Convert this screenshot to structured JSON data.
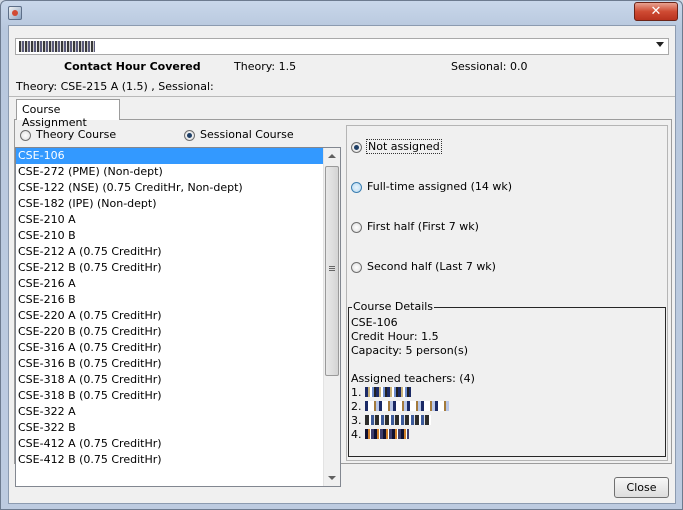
{
  "window": {
    "close_glyph": "✕",
    "app_icon": "java-cup-icon"
  },
  "header": {
    "course_combo": {
      "value_is_obscured": true,
      "arrow_icon": "chevron-down-icon"
    },
    "contact_title": "Contact Hour Covered",
    "theory_label": "Theory: 1.5",
    "sessional_label": "Sessional: 0.0",
    "summary": "Theory: CSE-215 A (1.5) , Sessional:"
  },
  "tabs": [
    {
      "label": "Course Assignment"
    }
  ],
  "course_type": {
    "options": [
      {
        "label": "Theory Course",
        "checked": false
      },
      {
        "label": "Sessional Course",
        "checked": true
      }
    ]
  },
  "courses": {
    "selected_index": 0,
    "items": [
      "CSE-106",
      "CSE-272 (PME) (Non-dept)",
      "CSE-122 (NSE) (0.75 CreditHr, Non-dept)",
      "CSE-182 (IPE) (Non-dept)",
      "CSE-210 A",
      "CSE-210 B",
      "CSE-212 A (0.75 CreditHr)",
      "CSE-212 B (0.75 CreditHr)",
      "CSE-216 A",
      "CSE-216 B",
      "CSE-220 A (0.75 CreditHr)",
      "CSE-220 B (0.75 CreditHr)",
      "CSE-316 A (0.75 CreditHr)",
      "CSE-316 B (0.75 CreditHr)",
      "CSE-318 A (0.75 CreditHr)",
      "CSE-318 B (0.75 CreditHr)",
      "CSE-322 A",
      "CSE-322 B",
      "CSE-412 A (0.75 CreditHr)",
      "CSE-412 B (0.75 CreditHr)"
    ]
  },
  "assignment": {
    "options": [
      {
        "label": "Not assigned",
        "checked": true
      },
      {
        "label": "Full-time assigned (14 wk)",
        "checked": false
      },
      {
        "label": "First half (First 7 wk)",
        "checked": false
      },
      {
        "label": "Second half (Last 7 wk)",
        "checked": false
      }
    ]
  },
  "details": {
    "title": "Course Details",
    "code": "CSE-106",
    "credit": "Credit Hour: 1.5",
    "capacity": "Capacity: 5 person(s)",
    "teachers_label": "Assigned teachers: (4)",
    "teachers": [
      "1.",
      "2.",
      "3.",
      "4."
    ]
  },
  "footer": {
    "close_label": "Close"
  }
}
